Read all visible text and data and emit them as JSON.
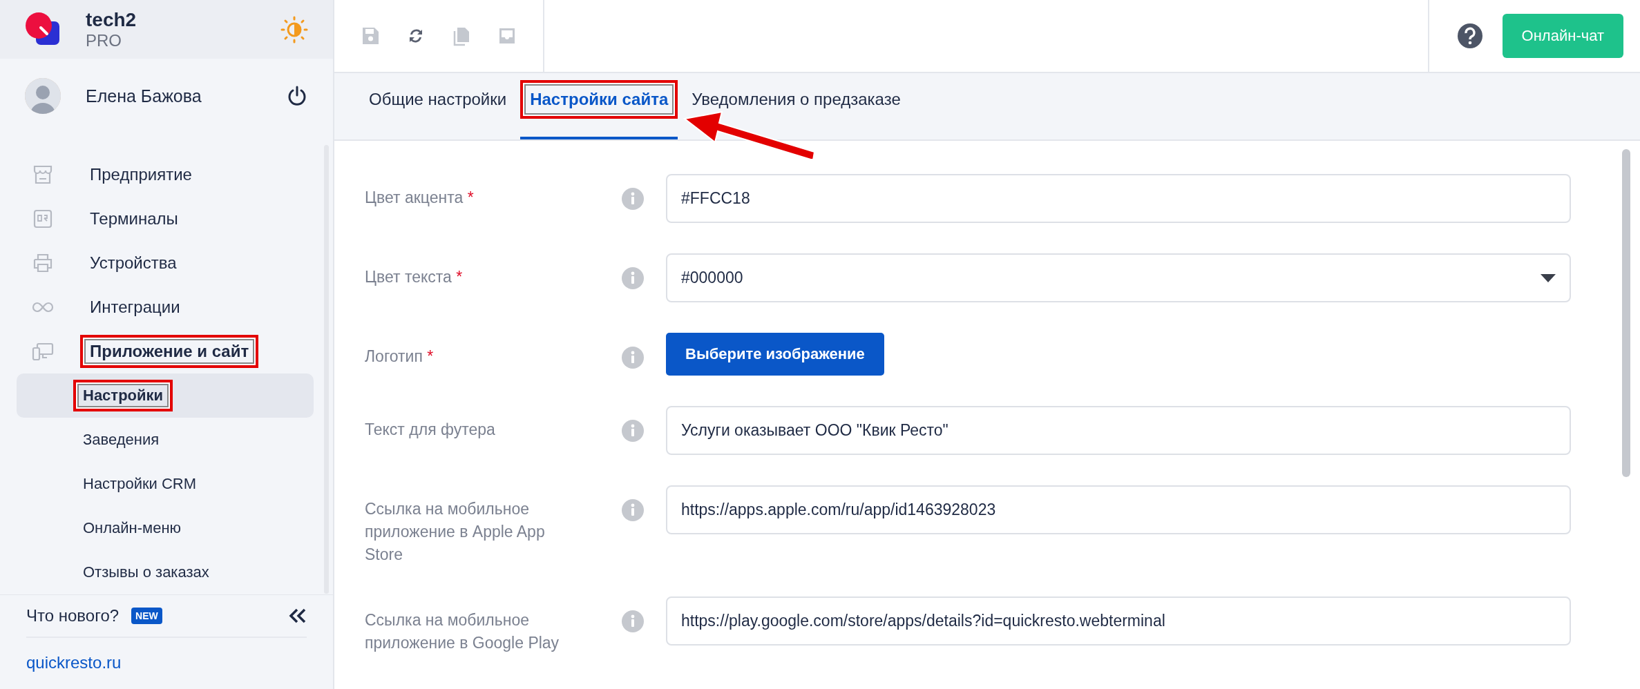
{
  "brand": {
    "name": "tech2",
    "plan": "PRO"
  },
  "user": {
    "name": "Елена Бажова"
  },
  "nav": [
    {
      "kind": "section",
      "label": "Предприятие",
      "expanded": false,
      "selected": false,
      "highlighted": false
    },
    {
      "kind": "section",
      "label": "Терминалы",
      "expanded": false,
      "selected": false,
      "highlighted": false
    },
    {
      "kind": "section",
      "label": "Устройства",
      "expanded": false,
      "selected": false,
      "highlighted": false
    },
    {
      "kind": "section",
      "label": "Интеграции",
      "expanded": false,
      "selected": false,
      "highlighted": false
    },
    {
      "kind": "section",
      "label": "Приложение и сайт",
      "expanded": true,
      "selected": false,
      "highlighted": true
    },
    {
      "kind": "subitem",
      "label": "Настройки",
      "selected": true,
      "highlighted": true
    },
    {
      "kind": "subitem",
      "label": "Заведения",
      "selected": false,
      "highlighted": false
    },
    {
      "kind": "subitem",
      "label": "Настройки CRM",
      "selected": false,
      "highlighted": false
    },
    {
      "kind": "subitem",
      "label": "Онлайн-меню",
      "selected": false,
      "highlighted": false
    },
    {
      "kind": "subitem",
      "label": "Отзывы о заказах",
      "selected": false,
      "highlighted": false
    }
  ],
  "whats_new": {
    "label": "Что нового?",
    "badge": "NEW"
  },
  "site_link": "quickresto.ru",
  "toolbar": [
    {
      "disabled": true
    },
    {
      "disabled": false
    },
    {
      "disabled": true
    },
    {
      "disabled": true
    }
  ],
  "chat_button": "Онлайн-чат",
  "tabs": [
    {
      "label": "Общие настройки",
      "selected": false,
      "highlighted": false
    },
    {
      "label": "Настройки сайта",
      "selected": true,
      "highlighted": true
    },
    {
      "label": "Уведомления о предзаказе",
      "selected": false,
      "highlighted": false
    }
  ],
  "form": [
    {
      "kind": "text",
      "label": "Цвет акцента",
      "required_mark": "*",
      "value": "#FFCC18"
    },
    {
      "kind": "select",
      "label": "Цвет текста",
      "required_mark": "*",
      "value": "#000000"
    },
    {
      "kind": "button",
      "label": "Логотип",
      "required_mark": "*",
      "value": "Выберите изображение"
    },
    {
      "kind": "text",
      "label": "Текст для футера",
      "value": "Услуги оказывает ООО \"Квик Ресто\""
    },
    {
      "kind": "text",
      "label": "Ссылка на мобильное приложение в Apple App Store",
      "value": "https://apps.apple.com/ru/app/id1463928023"
    },
    {
      "kind": "text",
      "label": "Ссылка на мобильное приложение в Google Play",
      "value": "https://play.google.com/store/apps/details?id=quickresto.webterminal"
    }
  ]
}
